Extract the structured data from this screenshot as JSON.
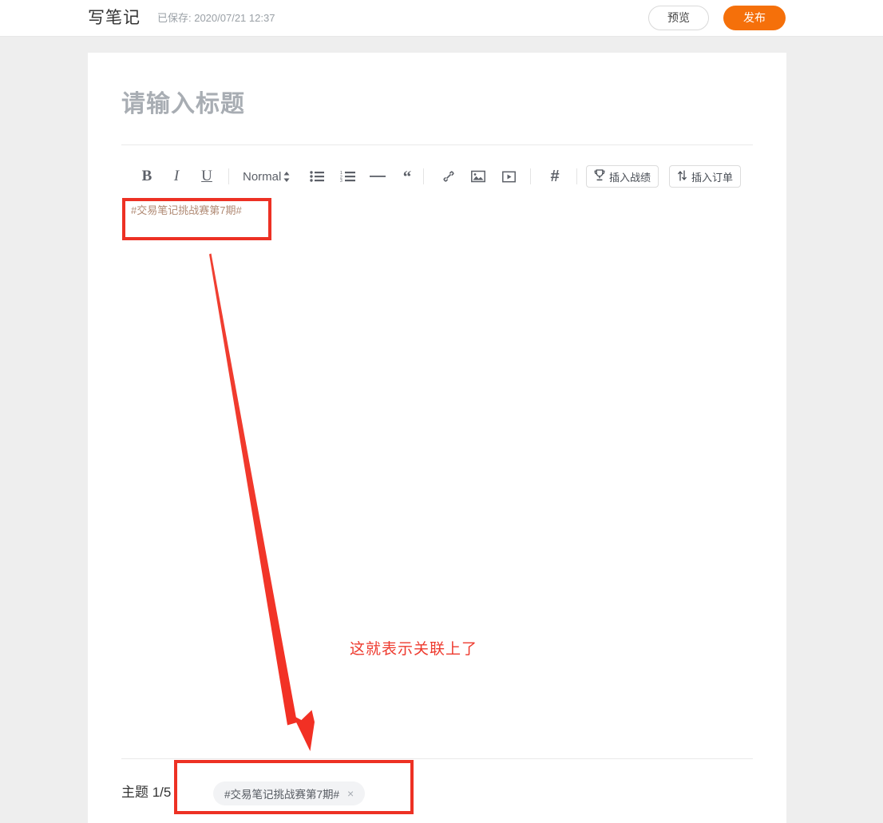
{
  "topbar": {
    "title": "写笔记",
    "saved_status": "已保存: 2020/07/21 12:37",
    "preview_label": "预览",
    "publish_label": "发布",
    "publish_color": "#f5700a"
  },
  "editor": {
    "title_placeholder": "请输入标题",
    "body_text": "#交易笔记挑战赛第7期#",
    "body_text_color": "#b08a74"
  },
  "toolbar": {
    "bold_label": "B",
    "italic_label": "I",
    "underline_label": "U",
    "format_select_value": "Normal",
    "bullet_list_label": "bullet-list",
    "numbered_list_label": "numbered-list",
    "horizontal_rule_label": "horizontal-rule",
    "blockquote_label": "“",
    "link_label": "link",
    "image_label": "image",
    "video_label": "video",
    "hashtag_label": "#",
    "insert_score_label": "插入战绩",
    "insert_order_label": "插入订单"
  },
  "footer": {
    "topic_counter": "主题 1/5",
    "tag_text": "#交易笔记挑战赛第7期#",
    "tag_remove_label": "×"
  },
  "annotations": {
    "callout_text": "这就表示关联上了",
    "highlight_color": "#ed3124",
    "text_color": "#ee3a2e"
  }
}
